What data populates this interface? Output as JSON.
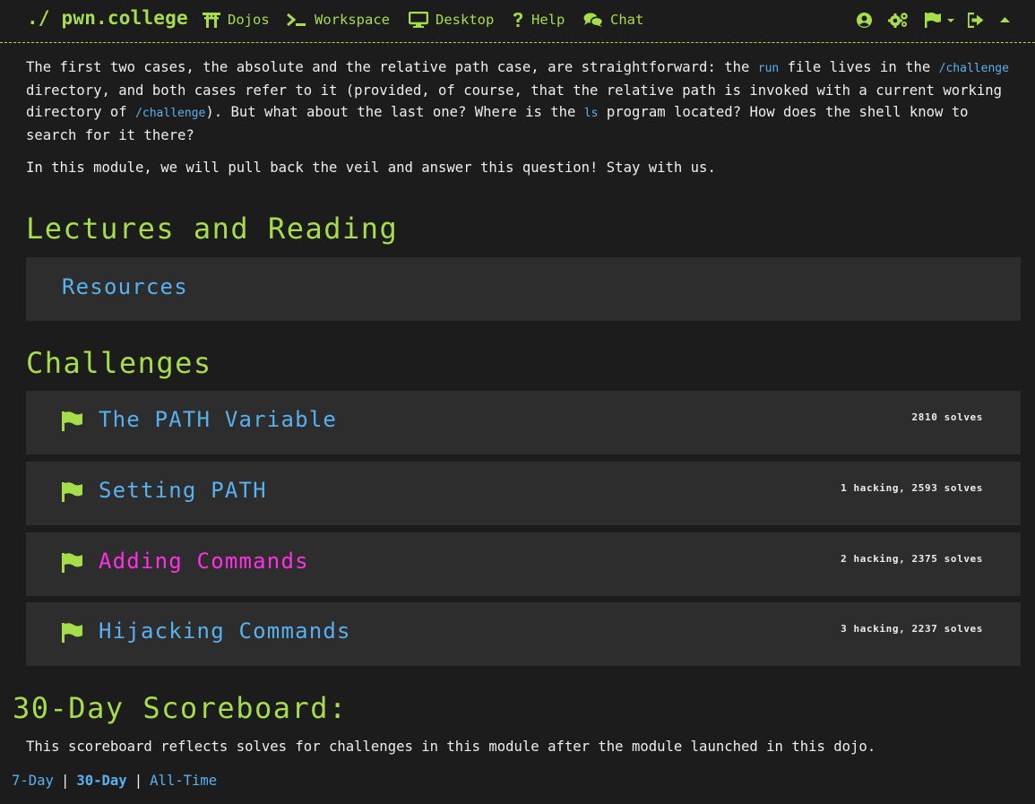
{
  "nav": {
    "brand": "./ pwn.college",
    "items": [
      {
        "label": "Dojos",
        "icon": "torii-icon"
      },
      {
        "label": "Workspace",
        "icon": "terminal-icon"
      },
      {
        "label": "Desktop",
        "icon": "monitor-icon"
      },
      {
        "label": "Help",
        "icon": "question-icon"
      },
      {
        "label": "Chat",
        "icon": "chat-icon"
      }
    ],
    "right_icons": [
      "user-circle-icon",
      "cogs-icon",
      "flag-dropdown-icon",
      "logout-icon",
      "collapse-caret-icon"
    ]
  },
  "intro": {
    "p1": {
      "t1": "The first two cases, the absolute and the relative path case, are straightforward: the ",
      "c1": "run",
      "t2": " file lives in the ",
      "c2": "/challenge",
      "t3": " directory, and both cases refer to it (provided, of course, that the relative path is invoked with a current working directory of ",
      "c3": "/challenge",
      "t4": "). But what about the last one? Where is the ",
      "c4": "ls",
      "t5": " program located? How does the shell know to search for it there?"
    },
    "p2": "In this module, we will pull back the veil and answer this question! Stay with us."
  },
  "lectures": {
    "heading": "Lectures and Reading",
    "items": [
      {
        "label": "Resources"
      }
    ]
  },
  "challenges": {
    "heading": "Challenges",
    "items": [
      {
        "title": "The PATH Variable",
        "stats": "2810 solves",
        "accent": "#58b1ef"
      },
      {
        "title": "Setting PATH",
        "stats": "1 hacking, 2593 solves",
        "accent": "#58b1ef"
      },
      {
        "title": "Adding Commands",
        "stats": "2 hacking, 2375 solves",
        "accent": "#ff2fe6"
      },
      {
        "title": "Hijacking Commands",
        "stats": "3 hacking, 2237 solves",
        "accent": "#58b1ef"
      }
    ]
  },
  "scoreboard": {
    "heading": "30-Day Scoreboard:",
    "description": "This scoreboard reflects solves for challenges in this module after the module launched in this dojo.",
    "tabs": [
      {
        "label": "7-Day",
        "active": false
      },
      {
        "label": "30-Day",
        "active": true
      },
      {
        "label": "All-Time",
        "active": false
      }
    ],
    "separator": "|"
  },
  "colors": {
    "accent": "#a6dd4a",
    "link": "#58b1ef",
    "highlight": "#ff2fe6",
    "background": "#1c1c1c",
    "card": "#2d2d2d"
  }
}
